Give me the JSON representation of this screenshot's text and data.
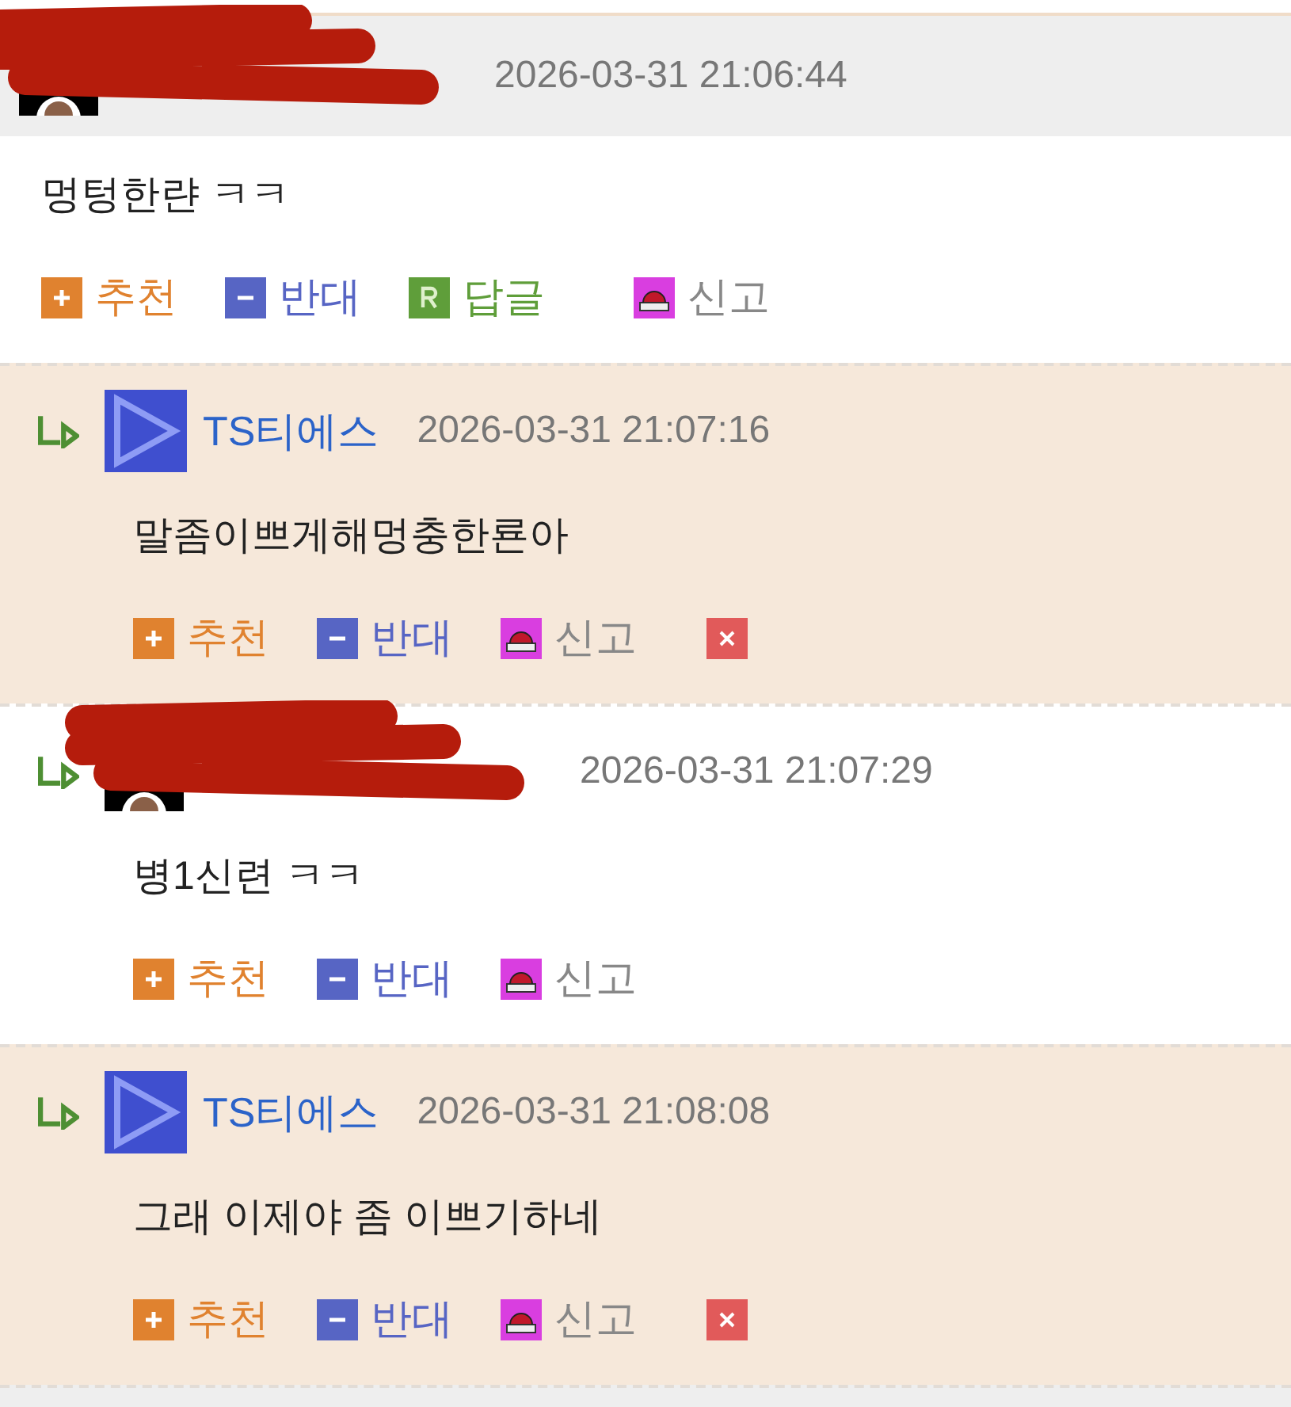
{
  "comments": [
    {
      "kind": "comment",
      "redacted": true,
      "highlighted": false,
      "time": "2026-03-31 21:06:44",
      "body": "멍텅한랸 ㅋㅋ",
      "actions": [
        {
          "kind": "recommend",
          "label": "추천"
        },
        {
          "kind": "oppose",
          "label": "반대"
        },
        {
          "kind": "reply",
          "label": "답글"
        },
        {
          "kind": "report",
          "label": "신고"
        }
      ]
    },
    {
      "kind": "reply",
      "redacted": false,
      "highlighted": true,
      "author": "TS티에스",
      "time": "2026-03-31 21:07:16",
      "body": "말좀이쁘게해멍충한룐아",
      "actions": [
        {
          "kind": "recommend",
          "label": "추천"
        },
        {
          "kind": "oppose",
          "label": "반대"
        },
        {
          "kind": "report",
          "label": "신고"
        },
        {
          "kind": "delete"
        }
      ]
    },
    {
      "kind": "reply",
      "redacted": true,
      "highlighted": false,
      "time": "2026-03-31 21:07:29",
      "body": "병1신련 ㅋㅋ",
      "actions": [
        {
          "kind": "recommend",
          "label": "추천"
        },
        {
          "kind": "oppose",
          "label": "반대"
        },
        {
          "kind": "report",
          "label": "신고"
        }
      ]
    },
    {
      "kind": "reply",
      "redacted": false,
      "highlighted": true,
      "author": "TS티에스",
      "time": "2026-03-31 21:08:08",
      "body": "그래 이제야 좀 이쁘기하네",
      "actions": [
        {
          "kind": "recommend",
          "label": "추천"
        },
        {
          "kind": "oppose",
          "label": "반대"
        },
        {
          "kind": "report",
          "label": "신고"
        },
        {
          "kind": "delete"
        }
      ]
    }
  ]
}
